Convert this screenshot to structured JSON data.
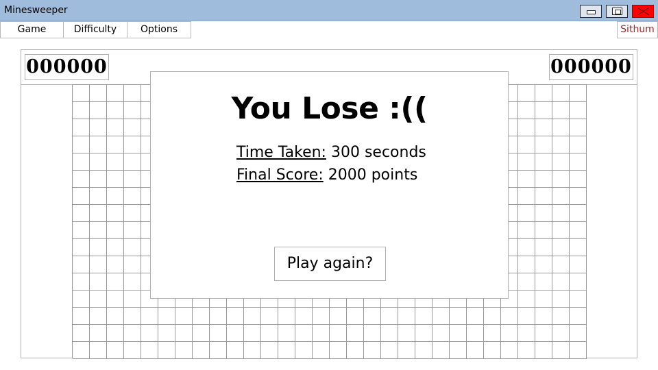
{
  "window": {
    "title": "Minesweeper",
    "controls": [
      "minimize-icon",
      "maximize-icon",
      "close-icon"
    ],
    "close_color": "#ff0000",
    "titlebar_color": "#a0bcdc"
  },
  "menu": {
    "items": [
      "Game",
      "Difficulty",
      "Options"
    ],
    "user": "Sithum",
    "user_color": "#9b2a2a"
  },
  "counters": {
    "left": "000000",
    "right": "000000"
  },
  "board": {
    "columns": 30,
    "rows": 16
  },
  "result_dialog": {
    "title": "You Lose :((",
    "time_label": "Time Taken:",
    "time_value": "300 seconds",
    "score_label": "Final Score:",
    "score_value": "2000 points",
    "button": "Play again?"
  }
}
